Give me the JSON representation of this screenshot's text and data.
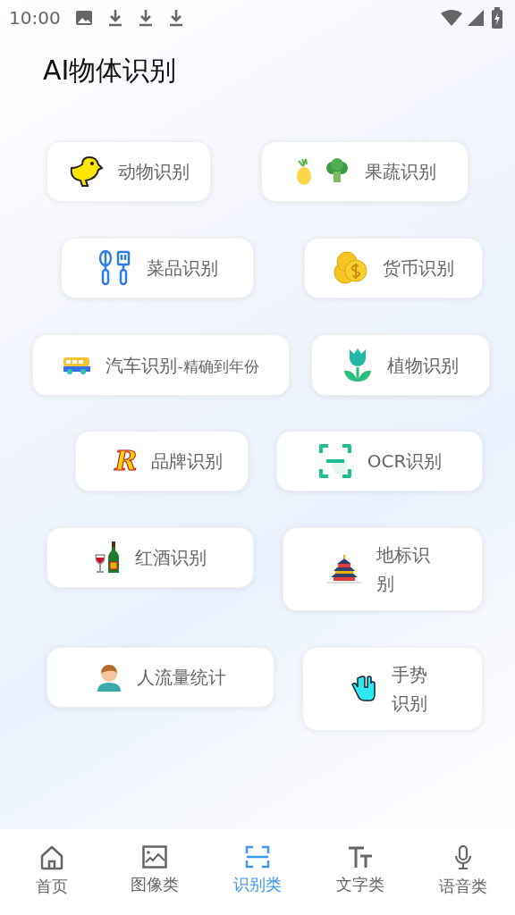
{
  "status_bar": {
    "time": "10:00"
  },
  "title": "AI物体识别",
  "features": [
    {
      "label": "动物识别"
    },
    {
      "label": "果蔬识别"
    },
    {
      "label": "菜品识别"
    },
    {
      "label": "货币识别"
    },
    {
      "label": "汽车识别",
      "note": "-精确到年份"
    },
    {
      "label": "植物识别"
    },
    {
      "label": "品牌识别",
      "icon_text": "R"
    },
    {
      "label": "OCR识别"
    },
    {
      "label": "红酒识别"
    },
    {
      "label": "地标识别"
    },
    {
      "label": "人流量统计"
    },
    {
      "label": "手势识别"
    }
  ],
  "tabs": [
    {
      "label": "首页",
      "selected": false
    },
    {
      "label": "图像类",
      "selected": false
    },
    {
      "label": "识别类",
      "selected": true
    },
    {
      "label": "文字类",
      "selected": false
    },
    {
      "label": "语音类",
      "selected": false
    }
  ]
}
